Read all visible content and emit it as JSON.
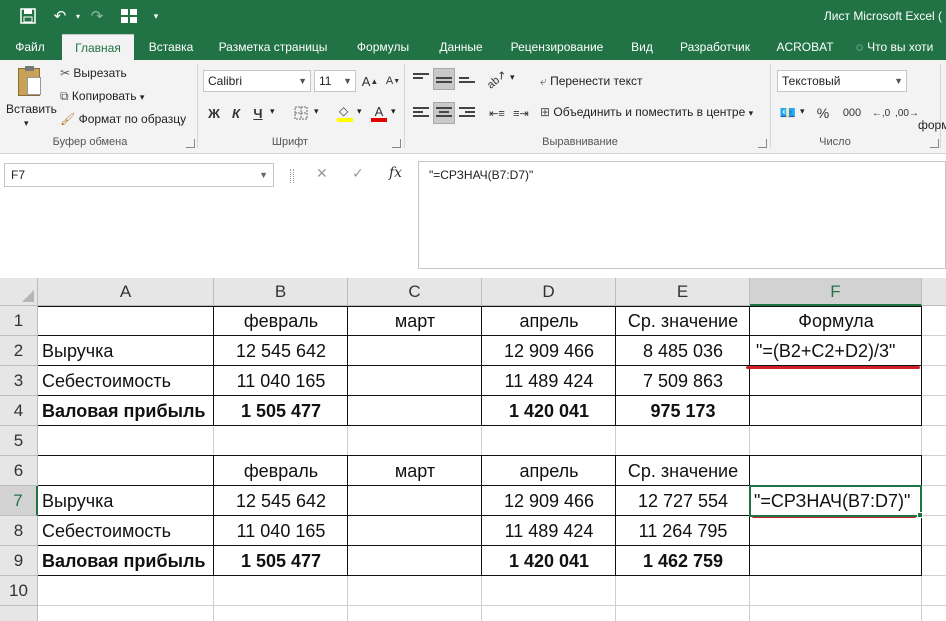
{
  "titlebar": {
    "title": "Лист Microsoft Excel (",
    "icons": [
      "save-icon",
      "undo-icon",
      "redo-icon",
      "form-icon",
      "customize-icon"
    ]
  },
  "tabs": [
    "Файл",
    "Главная",
    "Вставка",
    "Разметка страницы",
    "Формулы",
    "Данные",
    "Рецензирование",
    "Вид",
    "Разработчик",
    "ACROBAT",
    "Что вы хоти"
  ],
  "active_tab": "Главная",
  "ribbon": {
    "clipboard": {
      "paste": "Вставить",
      "cut": "Вырезать",
      "copy": "Копировать",
      "format_painter": "Формат по образцу",
      "label": "Буфер обмена"
    },
    "font": {
      "name": "Calibri",
      "size": "11",
      "bold": "Ж",
      "italic": "К",
      "underline": "Ч",
      "grow": "A",
      "shrink": "A",
      "font_color_letter": "A",
      "label": "Шрифт"
    },
    "alignment": {
      "wrap": "Перенести текст",
      "merge": "Объединить и поместить в центре",
      "label": "Выравнивание"
    },
    "number": {
      "format": "Текстовый",
      "percent": "%",
      "thousands": "000",
      "label": "Число"
    },
    "styles_partial": "форм"
  },
  "formula_bar": {
    "name_box": "F7",
    "cancel": "✕",
    "enter": "✓",
    "fx": "fx",
    "content": "\"=СРЗНАЧ(B7:D7)\""
  },
  "sheet": {
    "columns": [
      "A",
      "B",
      "C",
      "D",
      "E",
      "F"
    ],
    "rows": [
      "1",
      "2",
      "3",
      "4",
      "5",
      "6",
      "7",
      "8",
      "9",
      "10"
    ],
    "selected_cell": "F7",
    "cells": {
      "r1": [
        "",
        "февраль",
        "март",
        "апрель",
        "Ср. значение",
        "Формула"
      ],
      "r2": [
        "Выручка",
        "12 545 642",
        "",
        "12 909 466",
        "8 485 036",
        "\"=(B2+C2+D2)/3\""
      ],
      "r3": [
        "Себестоимость",
        "11 040 165",
        "",
        "11 489 424",
        "7 509 863",
        ""
      ],
      "r4": [
        "Валовая прибыль",
        "1 505 477",
        "",
        "1 420 041",
        "975 173",
        ""
      ],
      "r5": [
        "",
        "",
        "",
        "",
        "",
        ""
      ],
      "r6": [
        "",
        "февраль",
        "март",
        "апрель",
        "Ср. значение",
        ""
      ],
      "r7": [
        "Выручка",
        "12 545 642",
        "",
        "12 909 466",
        "12 727 554",
        "\"=СРЗНАЧ(B7:D7)\""
      ],
      "r8": [
        "Себестоимость",
        "11 040 165",
        "",
        "11 489 424",
        "11 264 795",
        ""
      ],
      "r9": [
        "Валовая прибыль",
        "1 505 477",
        "",
        "1 420 041",
        "1 462 759",
        ""
      ],
      "r10": [
        "",
        "",
        "",
        "",
        "",
        ""
      ]
    }
  },
  "colors": {
    "excel_green": "#217346",
    "red_underline": "#d11f2a",
    "ribbon_bg": "#f3f3f3"
  }
}
